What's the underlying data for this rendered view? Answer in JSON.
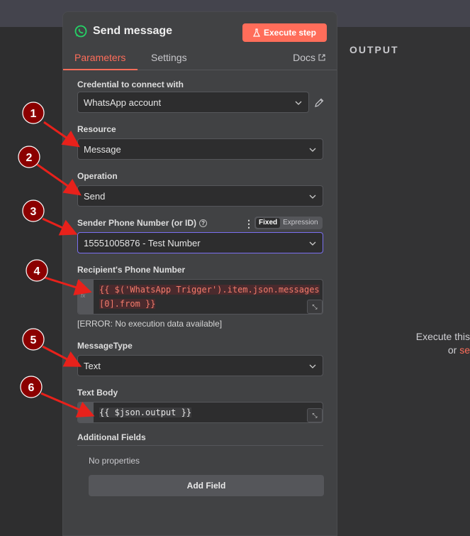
{
  "node": {
    "title": "Send message",
    "execute_label": "Execute step"
  },
  "tabs": [
    {
      "label": "Parameters",
      "active": true
    },
    {
      "label": "Settings",
      "active": false
    }
  ],
  "docs_label": "Docs",
  "fields": {
    "credential": {
      "label": "Credential to connect with",
      "value": "WhatsApp account"
    },
    "resource": {
      "label": "Resource",
      "value": "Message"
    },
    "operation": {
      "label": "Operation",
      "value": "Send"
    },
    "sender": {
      "label": "Sender Phone Number (or ID)",
      "value": "15551005876 - Test Number",
      "mode_fixed": "Fixed",
      "mode_expression": "Expression"
    },
    "recipient": {
      "label": "Recipient's Phone Number",
      "expression_line1": "{{ $('WhatsApp Trigger').item.json.messages",
      "expression_line2": "[0].from }}",
      "error": "[ERROR: No execution data available]"
    },
    "message_type": {
      "label": "MessageType",
      "value": "Text"
    },
    "text_body": {
      "label": "Text Body",
      "expression": "{{ $json.output }}"
    }
  },
  "additional_fields": {
    "label": "Additional Fields",
    "empty_text": "No properties",
    "add_label": "Add Field"
  },
  "output": {
    "label": "OUTPUT",
    "hint_line1": "Execute this",
    "hint_line2_prefix": "or",
    "hint_line2_link": "se"
  },
  "annotations": [
    "1",
    "2",
    "3",
    "4",
    "5",
    "6"
  ],
  "colors": {
    "accent": "#ff6d5a",
    "annotation": "#8b0000",
    "arrow": "#e8211b",
    "focus": "#7a6ff0"
  }
}
